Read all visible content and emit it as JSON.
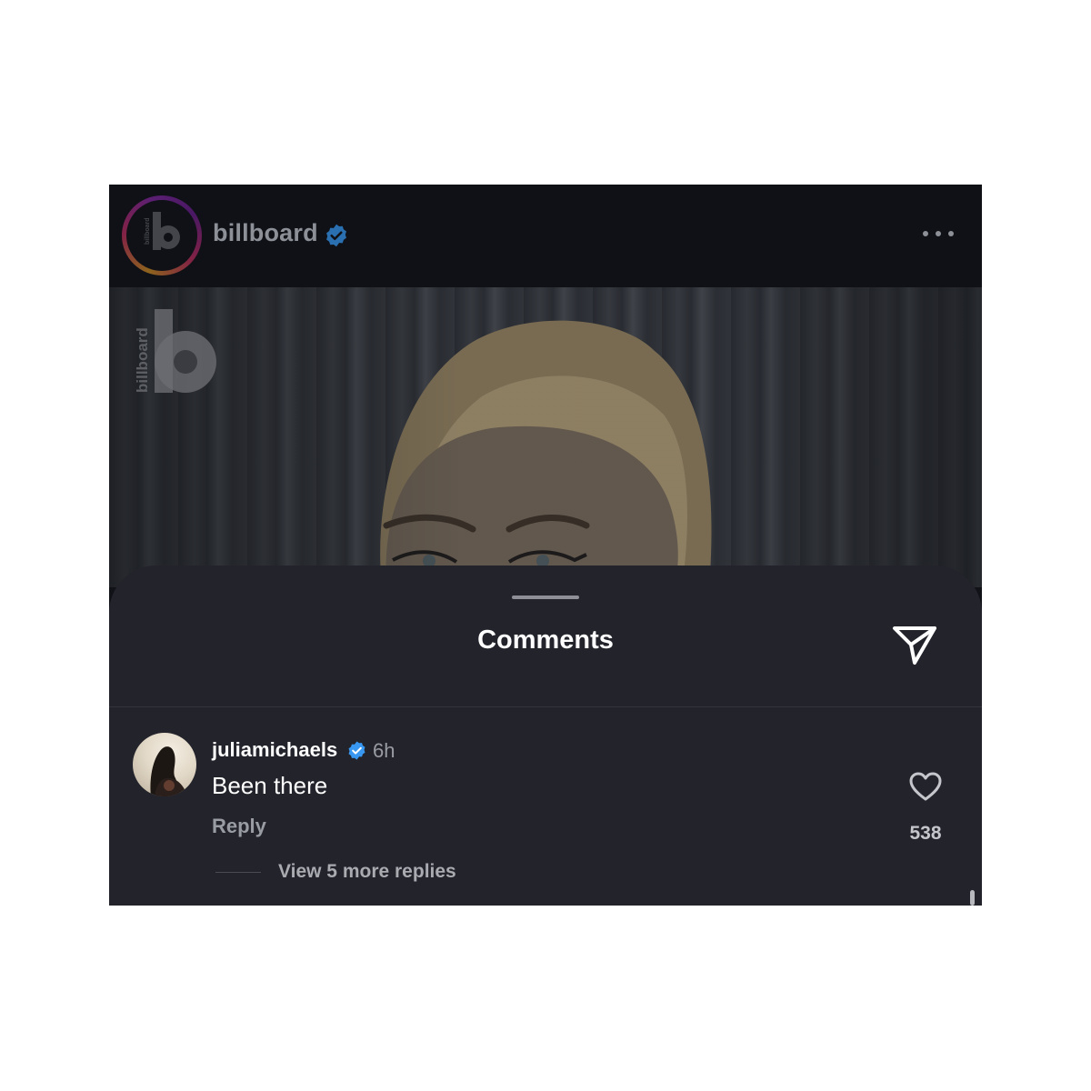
{
  "post": {
    "username": "billboard",
    "avatar_icon": "billboard-logo-icon",
    "verified_icon": "verified-badge-icon",
    "more_icon": "more-options-icon",
    "photo_watermark_icon": "billboard-logo-icon"
  },
  "comments_sheet": {
    "title": "Comments",
    "share_icon": "send-icon",
    "comments": [
      {
        "username": "juliamichaels",
        "verified": true,
        "time": "6h",
        "text": "Been there",
        "reply_label": "Reply",
        "like_count": "538",
        "view_replies_label": "View 5 more replies"
      }
    ]
  },
  "colors": {
    "header_bg": "#0f1117",
    "sheet_bg": "#22232b",
    "verified_blue": "#3897f0",
    "muted_text": "#9a9ca3"
  }
}
